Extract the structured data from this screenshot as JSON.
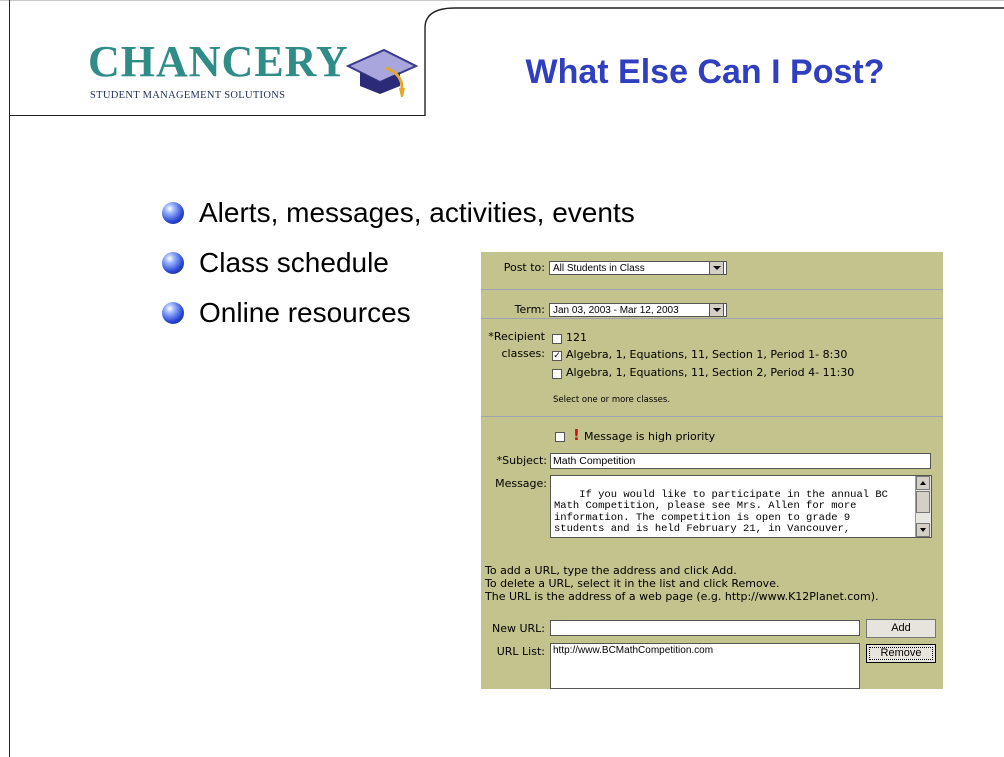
{
  "slide": {
    "title": "What Else Can I Post?",
    "logo": {
      "word": "CHANCERY",
      "tagline": "STUDENT MANAGEMENT SOLUTIONS"
    },
    "bullets": [
      "Alerts, messages, activities, events",
      "Class schedule",
      "Online resources"
    ],
    "colors": {
      "title": "#2f3fbf",
      "logo": "#2f8c87",
      "form_bg": "#c3c38d"
    }
  },
  "form": {
    "post_to": {
      "label": "Post to:",
      "value": "All Students in Class"
    },
    "term": {
      "label": "Term:",
      "value": "Jan 03, 2003 - Mar 12, 2003"
    },
    "recipient": {
      "label_line1": "*Recipient",
      "label_line2": "classes:",
      "options": [
        {
          "text": "121",
          "checked": false
        },
        {
          "text": "Algebra, 1, Equations, 11, Section 1, Period 1- 8:30",
          "checked": true
        },
        {
          "text": "Algebra, 1, Equations, 11, Section 2, Period 4- 11:30",
          "checked": false
        }
      ],
      "note": "Select one or more classes."
    },
    "priority": {
      "text": "Message is high priority",
      "checked": false,
      "icon": "exclamation-icon"
    },
    "subject": {
      "label": "*Subject:",
      "value": "Math Competition"
    },
    "message": {
      "label": "Message:",
      "value": "If you would like to participate in the annual BC\nMath Competition, please see Mrs. Allen for more\ninformation. The competition is open to grade 9\nstudents and is held February 21, in Vancouver,"
    },
    "help": {
      "line1": "To add a URL, type the address and click Add.",
      "line2": "To delete a URL, select it in the list and click Remove.",
      "line3": "The URL is the address of a web page (e.g. http://www.K12Planet.com)."
    },
    "new_url": {
      "label": "New URL:",
      "value": "",
      "button": "Add"
    },
    "url_list": {
      "label": "URL List:",
      "items": [
        "http://www.BCMathCompetition.com"
      ],
      "button": "Remove"
    }
  }
}
